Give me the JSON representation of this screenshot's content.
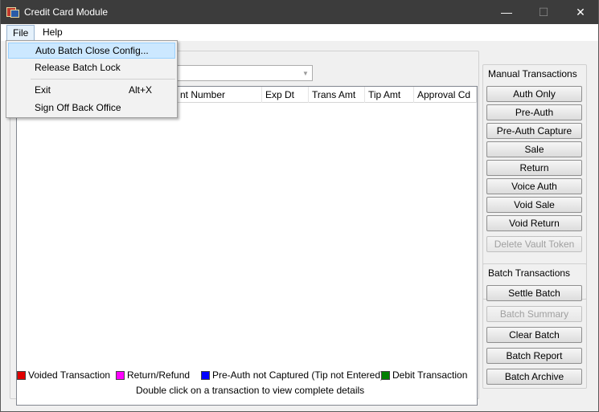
{
  "window": {
    "title": "Credit Card Module"
  },
  "menubar": {
    "file": "File",
    "help": "Help"
  },
  "file_menu": {
    "items": [
      {
        "label": "Auto Batch Close Config...",
        "shortcut": ""
      },
      {
        "label": "Release Batch Lock",
        "shortcut": ""
      },
      {
        "label": "Exit",
        "shortcut": "Alt+X"
      },
      {
        "label": "Sign Off Back Office",
        "shortcut": ""
      }
    ]
  },
  "grid": {
    "columns": [
      "nt Number",
      "Exp Dt",
      "Trans Amt",
      "Tip Amt",
      "Approval Cd"
    ]
  },
  "legend": [
    {
      "label": "Voided Transaction",
      "color": "#e00000"
    },
    {
      "label": "Return/Refund",
      "color": "#ff00ff"
    },
    {
      "label": "Pre-Auth not Captured (Tip not Entered)",
      "color": "#0000ff"
    },
    {
      "label": "Debit Transaction",
      "color": "#008000"
    }
  ],
  "hint": "Double click on a transaction to view complete details",
  "manual_transactions": {
    "caption": "Manual Transactions",
    "buttons": [
      "Auth Only",
      "Pre-Auth",
      "Pre-Auth Capture",
      "Sale",
      "Return",
      "Voice Auth",
      "Void Sale",
      "Void Return",
      "Delete Vault Token"
    ]
  },
  "batch_transactions": {
    "caption": "Batch Transactions",
    "buttons": [
      "Settle Batch",
      "Batch Summary",
      "Clear Batch",
      "Batch Report",
      "Batch Archive"
    ]
  }
}
